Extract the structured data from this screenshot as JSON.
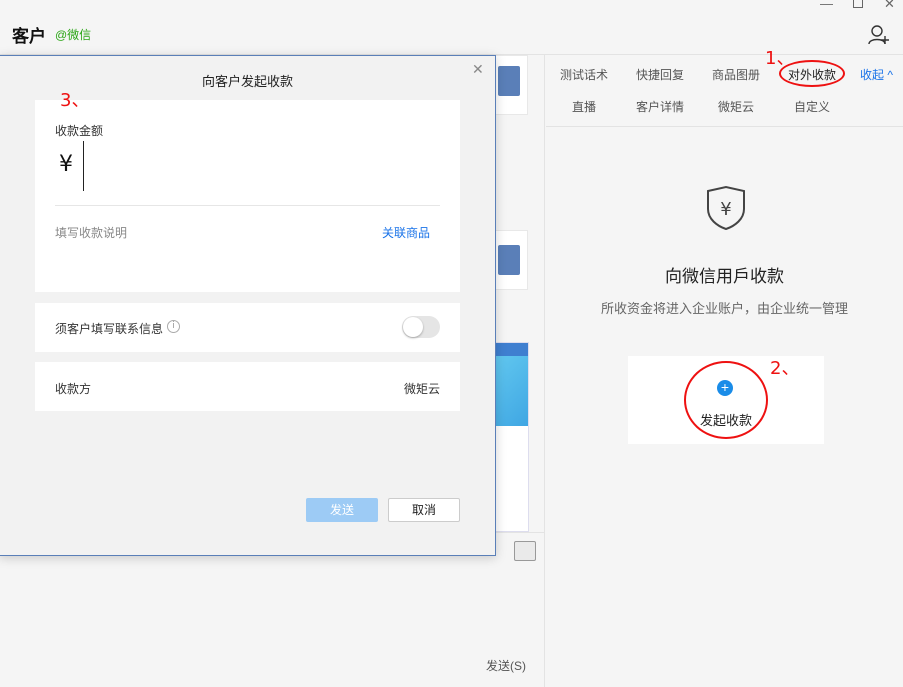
{
  "header": {
    "title": "客户",
    "subtitle": "@微信"
  },
  "right_panel": {
    "tabs": [
      "测试话术",
      "快捷回复",
      "商品图册",
      "对外收款",
      "收起",
      "直播",
      "客户详情",
      "微矩云",
      "自定义"
    ],
    "title": "向微信用戶收款",
    "description": "所收资金将进入企业账户，由企业统一管理",
    "action_label": "发起收款"
  },
  "chat": {
    "send_label": "发送(S)"
  },
  "dialog": {
    "title": "向客户发起收款",
    "amount_label": "收款金额",
    "currency_symbol": "¥",
    "description_placeholder": "填写收款说明",
    "link_goods": "关联商品",
    "contact_info_label": "须客户填写联系信息",
    "payee_label": "收款方",
    "payee_value": "微矩云",
    "send_button": "发送",
    "cancel_button": "取消"
  },
  "annotations": {
    "step1": "1、",
    "step2": "2、",
    "step3": "3、"
  },
  "colors": {
    "accent": "#1a73e8",
    "annotation": "#ee1111",
    "wechat_green": "#2aa515"
  }
}
